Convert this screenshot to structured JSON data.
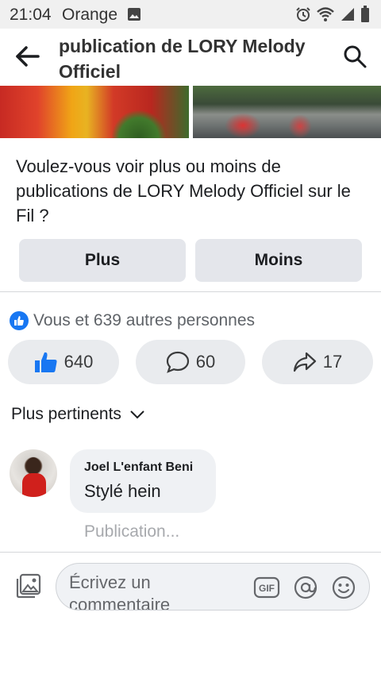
{
  "status": {
    "time": "21:04",
    "carrier": "Orange"
  },
  "header": {
    "title": "publication de LORY Melody Officiel"
  },
  "prompt": {
    "text": "Voulez-vous voir plus ou moins de publications de LORY Melody Officiel sur le Fil ?",
    "plus_label": "Plus",
    "moins_label": "Moins"
  },
  "reactions": {
    "summary": "Vous et 639 autres personnes",
    "like_count": "640",
    "comment_count": "60",
    "share_count": "17"
  },
  "sort": {
    "label": "Plus pertinents"
  },
  "comment": {
    "author": "Joel L'enfant Beni",
    "text": "Stylé hein",
    "status": "Publication..."
  },
  "composer": {
    "placeholder": "Écrivez un commentaire"
  },
  "colors": {
    "accent": "#1877f2",
    "button_bg": "#e4e6eb"
  }
}
